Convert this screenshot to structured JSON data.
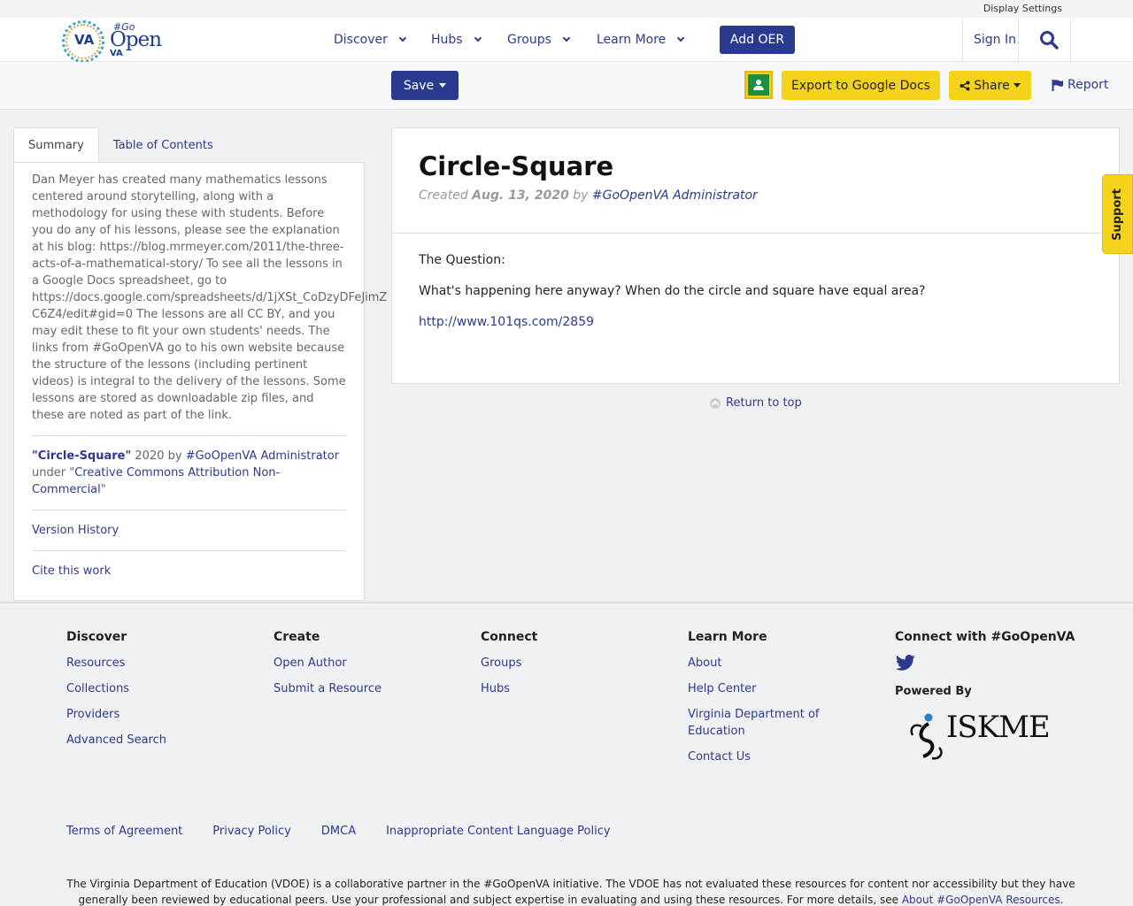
{
  "topstrip": {
    "display_settings": "Display Settings"
  },
  "header": {
    "logo": {
      "va": "VA",
      "go": "#Go",
      "open": "Open",
      "va2": "VA"
    },
    "nav": [
      {
        "label": "Discover"
      },
      {
        "label": "Hubs"
      },
      {
        "label": "Groups"
      },
      {
        "label": "Learn More"
      }
    ],
    "add_oer": "Add OER",
    "sign_in": "Sign In"
  },
  "toolbar": {
    "save": "Save",
    "export": "Export to Google Docs",
    "share": "Share",
    "report": "Report"
  },
  "sidebar": {
    "tabs": [
      "Summary",
      "Table of Contents"
    ],
    "summary_text": "Dan Meyer has created many mathematics lessons centered around storytelling, along with a methodology for using these with students. Before you do any of his lessons, please see the explanation at his blog: https://blog.mrmeyer.com/2011/the-three-acts-of-a-mathematical-story/ To see all the lessons in a Google Docs spreadsheet, go to",
    "summary_url": "https://docs.google.com/spreadsheets/d/1jXSt_CoDzyDFeJimZ",
    "summary_rest": "C6Z4/edit#gid=0 The lessons are all CC BY, and you may edit these to fit your own students' needs. The links from #GoOpenVA go to his own website because the structure of the lessons (including pertinent videos) is integral to the delivery of the lessons. Some lessons are stored as downloadable zip files, and these are noted as part of the link.",
    "attribution": {
      "title": "Circle-Square",
      "year_by": " 2020 by ",
      "author": "#GoOpenVA Administrator",
      "under": "under \"",
      "license": "Creative Commons Attribution Non-Commercial",
      "close_quote": "\""
    },
    "version_history": "Version History",
    "cite": "Cite this work"
  },
  "content": {
    "title": "Circle-Square",
    "created_label": "Created ",
    "created_date": "Aug. 13, 2020",
    "by": " by ",
    "author": "#GoOpenVA Administrator",
    "body_heading": "The Question:",
    "body_question": "What's happening here anyway? When do the circle and square have equal area?",
    "body_link": "http://www.101qs.com/2859"
  },
  "return_to_top": "Return to top",
  "support": "Support",
  "footer": {
    "columns": [
      {
        "title": "Discover",
        "links": [
          "Resources",
          "Collections",
          "Providers",
          "Advanced Search"
        ]
      },
      {
        "title": "Create",
        "links": [
          "Open Author",
          "Submit a Resource"
        ]
      },
      {
        "title": "Connect",
        "links": [
          "Groups",
          "Hubs"
        ]
      },
      {
        "title": "Learn More",
        "links": [
          "About",
          "Help Center",
          "Virginia Department of Education",
          "Contact Us"
        ]
      }
    ],
    "connect_title": "Connect with #GoOpenVA",
    "powered_by": "Powered By",
    "iskme": "ISKME",
    "legal": [
      "Terms of Agreement",
      "Privacy Policy",
      "DMCA",
      "Inappropriate Content Language Policy"
    ],
    "disclaimer": "The Virginia Department of Education (VDOE) is a collaborative partner in the #GoOpenVA initiative. The VDOE has not evaluated these resources for content nor accessibility but they have generally been reviewed by educational peers. Use your professional and subject expertise in evaluating and using these resources. For more details, see ",
    "disclaimer_link": "About #GoOpenVA Resources",
    "disclaimer_end": "."
  },
  "colors": {
    "brand": "#2a3b8f",
    "accent": "#f5d31b"
  }
}
